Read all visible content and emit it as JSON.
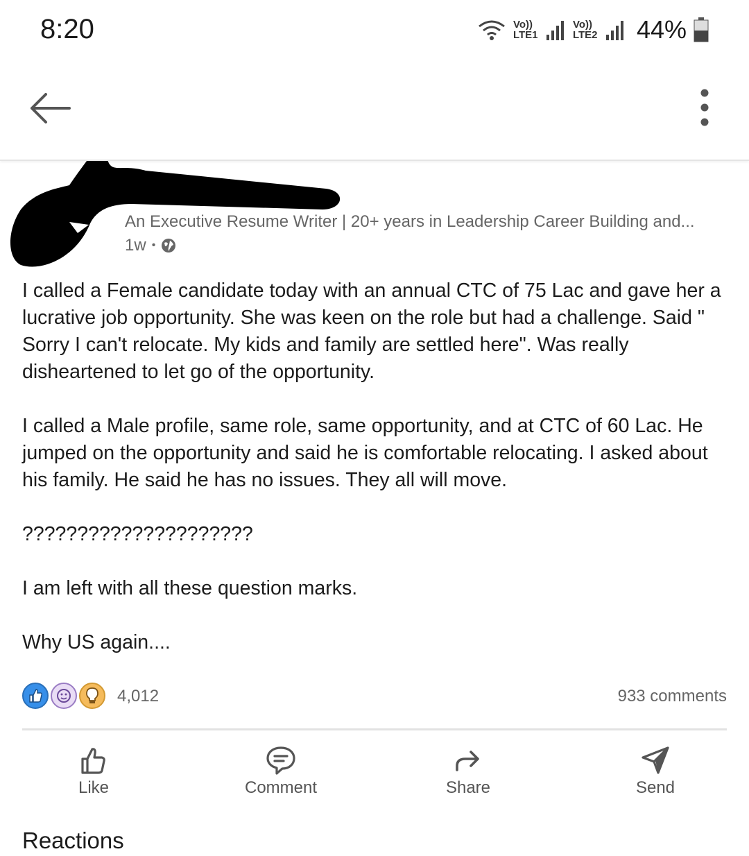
{
  "status_bar": {
    "time": "8:20",
    "sim1_label": "Vo)) LTE1",
    "sim2_label": "Vo)) LTE2",
    "battery": "44%"
  },
  "post": {
    "author_subtitle": "An Executive Resume Writer | 20+ years in Leadership Career Building and...",
    "age": "1w",
    "paragraphs": [
      "I called a Female candidate today with an annual CTC of 75 Lac and gave her a lucrative job opportunity. She was keen on the role but had a challenge. Said \" Sorry I can't relocate. My kids and family are settled here\". Was really disheartened to let go of the opportunity.",
      "I called a Male profile, same role, same opportunity, and at CTC of 60 Lac. He jumped on the opportunity and said he is comfortable relocating. I asked about his family. He said he has no issues. They all will move.",
      "?????????????????????",
      "I am left with all these question marks.",
      "Why US again...."
    ],
    "reaction_count": "4,012",
    "comments_count": "933 comments"
  },
  "actions": {
    "like": "Like",
    "comment": "Comment",
    "share": "Share",
    "send": "Send"
  },
  "reactions_section_title": "Reactions",
  "colors": {
    "like_blue": "#378fe9",
    "empathy_purple": "#b59bd8",
    "insight_yellow": "#f5bb5c",
    "text_secondary": "#666666"
  }
}
